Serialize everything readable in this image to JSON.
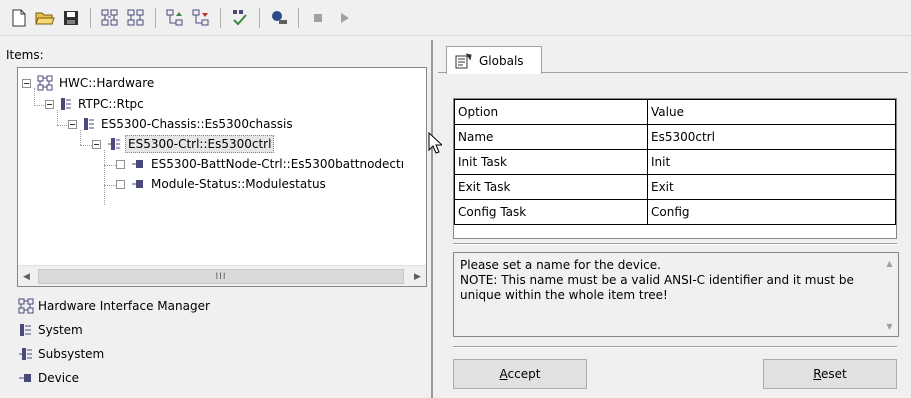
{
  "toolbar": {
    "icons": [
      "new-file-icon",
      "open-folder-icon",
      "save-icon",
      "tree-add-icon",
      "tree-remove-icon",
      "move-up-icon",
      "move-down-icon",
      "check-icon",
      "search-device-icon",
      "stop-icon",
      "play-icon"
    ]
  },
  "left": {
    "items_label": "Items:",
    "tree": [
      {
        "label": "HWC::Hardware",
        "icon": "hardware-interface-icon"
      },
      {
        "label": "RTPC::Rtpc",
        "icon": "system-icon"
      },
      {
        "label": "ES5300-Chassis::Es5300chassis",
        "icon": "system-icon"
      },
      {
        "label": "ES5300-Ctrl::Es5300ctrl",
        "icon": "subsystem-icon"
      },
      {
        "label": "ES5300-BattNode-Ctrl::Es5300battnodectı",
        "icon": "device-icon"
      },
      {
        "label": "Module-Status::Modulestatus",
        "icon": "device-icon"
      }
    ],
    "scroll_thumb_grip": "III",
    "legend": [
      {
        "label": "Hardware Interface Manager",
        "icon": "hardware-interface-icon"
      },
      {
        "label": "System",
        "icon": "system-icon"
      },
      {
        "label": "Subsystem",
        "icon": "subsystem-icon"
      },
      {
        "label": "Device",
        "icon": "device-icon"
      }
    ]
  },
  "right": {
    "tab_label": "Globals",
    "grid": {
      "headers": [
        "Option",
        "Value"
      ],
      "rows": [
        [
          "Name",
          "Es5300ctrl"
        ],
        [
          "Init Task",
          "Init"
        ],
        [
          "Exit Task",
          "Exit"
        ],
        [
          "Config Task",
          "Config"
        ]
      ]
    },
    "help_text": "Please set a name for the device.\nNOTE: This name must be a valid ANSI-C identifier and it must be unique within the whole item tree!",
    "accept_label": "Accept",
    "reset_label": "Reset"
  },
  "colors": {
    "background": "#f0f0f0",
    "icon_dark": "#4a4a7a",
    "icon_green": "#3a8a3a",
    "selection": "#e6e6e6"
  }
}
